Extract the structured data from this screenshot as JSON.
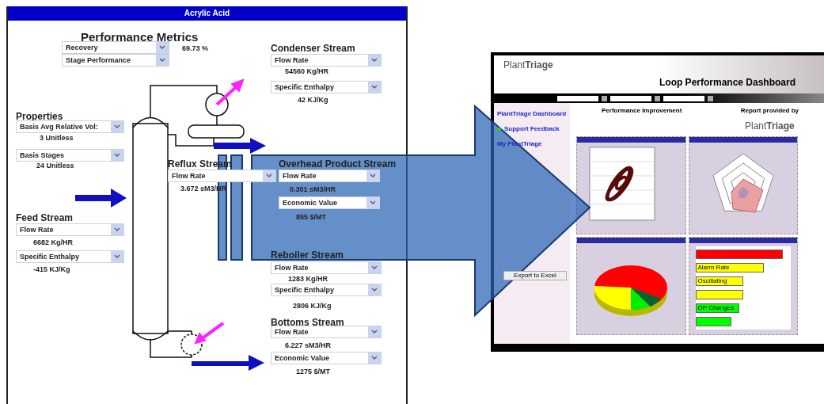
{
  "process_window": {
    "title": "Acrylic Acid",
    "sections": [
      {
        "title": "Performance Metrics",
        "selects": [
          {
            "label": "Recovery",
            "value": "69.73 %"
          },
          {
            "label": "Stage Performance"
          }
        ]
      },
      {
        "title": "Condenser Stream",
        "selects": [
          {
            "label": "Flow Rate",
            "value": "54560 Kg/HR"
          },
          {
            "label": "Specific Enthalpy",
            "value": "42 KJ/Kg"
          }
        ]
      },
      {
        "title": "Properties",
        "selects": [
          {
            "label": "Basis Avg Relative Vol:",
            "value": "3 Unitless"
          },
          {
            "label": "Basis Stages",
            "value": "24 Unitless"
          }
        ]
      },
      {
        "title": "Reflux Stream",
        "selects": [
          {
            "label": "Flow Rate",
            "value": "3.672 sM3/HR"
          }
        ]
      },
      {
        "title": "Overhead Product Stream",
        "selects": [
          {
            "label": "Flow Rate",
            "value": "0.301 sM3/HR"
          },
          {
            "label": "Economic Value",
            "value": "855 $/MT"
          }
        ]
      },
      {
        "title": "Feed Stream",
        "selects": [
          {
            "label": "Flow Rate",
            "value": "6682 Kg/HR"
          },
          {
            "label": "Specific Enthalpy",
            "value": "-415 KJ/Kg"
          }
        ]
      },
      {
        "title": "Reboiler Stream",
        "selects": [
          {
            "label": "Flow Rate",
            "value": "1283 Kg/HR"
          },
          {
            "label": "Specific Enthalpy",
            "value": "2806 KJ/Kg"
          }
        ]
      },
      {
        "title": "Bottoms Stream",
        "selects": [
          {
            "label": "Flow Rate",
            "value": "6.227 sM3/HR"
          },
          {
            "label": "Economic Value",
            "value": "1275 $/MT"
          }
        ]
      }
    ]
  },
  "dashboard": {
    "logo": "Plant**Triage**",
    "title": "Loop Performance Dashboard",
    "nav": [
      {
        "label": "PlantTriage Dashboard"
      },
      {
        "label": "Support Feedback",
        "color": "#22cc22"
      },
      {
        "label": "My PlantTriage"
      }
    ],
    "buttons": [
      "Export to Excel"
    ],
    "heading": "Performance Improvement",
    "report_label": "Report provided by",
    "report_logo": "Plant**Triage**",
    "panels": [
      {
        "kind": "scatter"
      },
      {
        "kind": "radar"
      },
      {
        "kind": "pie"
      },
      {
        "kind": "bars",
        "bars": [
          {
            "color": "#ff0000",
            "level": 0.92
          },
          {
            "label": "Alarm Rate",
            "color": "#ffff00",
            "level": 0.72
          },
          {
            "label": "Oscillating",
            "color": "#ffff00",
            "level": 0.5
          },
          {
            "color": "#ffff00",
            "level": 0.5
          },
          {
            "label": "OP Changes",
            "color": "#00ff00",
            "level": 0.46
          },
          {
            "color": "#00ff00",
            "level": 0.38
          }
        ]
      }
    ]
  }
}
